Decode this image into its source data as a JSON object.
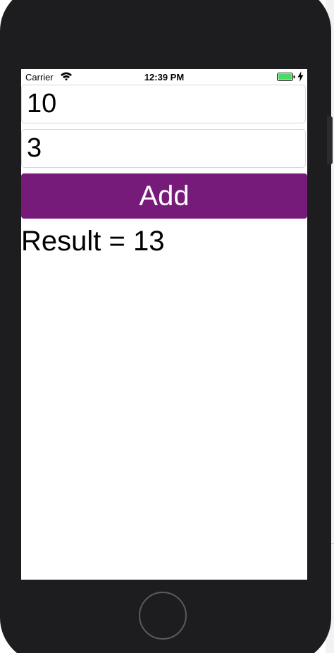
{
  "status_bar": {
    "carrier": "Carrier",
    "time": "12:39 PM",
    "wifi_icon": "wifi-icon",
    "battery_icon": "battery-charging-icon",
    "battery_color": "#4cd964"
  },
  "form": {
    "first_value": "10",
    "second_value": "3",
    "add_label": "Add",
    "button_color": "#771b7a"
  },
  "result": {
    "text": "Result = 13"
  },
  "device": {
    "home_button_icon": "home-button-icon"
  }
}
